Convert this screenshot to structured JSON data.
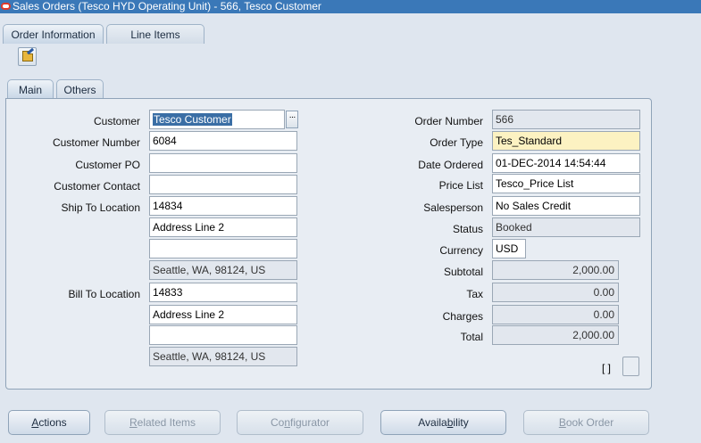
{
  "window": {
    "title": "Sales Orders (Tesco HYD Operating Unit) - 566, Tesco Customer"
  },
  "tabs": {
    "order_information": "Order Information",
    "line_items": "Line Items"
  },
  "subtabs": {
    "main": "Main",
    "others": "Others"
  },
  "labels": {
    "customer": "Customer",
    "customer_number": "Customer Number",
    "customer_po": "Customer PO",
    "customer_contact": "Customer Contact",
    "ship_to_location": "Ship To Location",
    "bill_to_location": "Bill To Location",
    "order_number": "Order Number",
    "order_type": "Order Type",
    "date_ordered": "Date Ordered",
    "price_list": "Price List",
    "salesperson": "Salesperson",
    "status": "Status",
    "currency": "Currency",
    "subtotal": "Subtotal",
    "tax": "Tax",
    "charges": "Charges",
    "total": "Total"
  },
  "values": {
    "customer": "Tesco Customer",
    "customer_number": "6084",
    "customer_po": "",
    "customer_contact": "",
    "ship_to_location": "14834",
    "ship_to_address1": "Address Line 2",
    "ship_to_address2": "",
    "ship_to_address3": "Seattle, WA, 98124, US",
    "bill_to_location": "14833",
    "bill_to_address1": "Address Line 2",
    "bill_to_address2": "",
    "bill_to_address3": "Seattle, WA, 98124, US",
    "order_number": "566",
    "order_type": "Tes_Standard",
    "date_ordered": "01-DEC-2014 14:54:44",
    "price_list": "Tesco_Price List",
    "salesperson": "No Sales Credit",
    "status": "Booked",
    "currency": "USD",
    "subtotal": "2,000.00",
    "tax": "0.00",
    "charges": "0.00",
    "total": "2,000.00"
  },
  "lov_glyph": "···",
  "flex_brackets": "[ ]",
  "buttons": {
    "actions": {
      "first": "A",
      "rest": "ctions"
    },
    "related_items": {
      "first": "R",
      "rest": "elated Items"
    },
    "configurator": {
      "pre": "Co",
      "mid": "n",
      "rest": "figurator"
    },
    "availability": {
      "pre": "Availa",
      "mid": "b",
      "rest": "ility"
    },
    "book_order": {
      "first": "B",
      "rest": "ook Order"
    }
  },
  "icons": {
    "oracle": "oracle-icon",
    "open_folder": "open-folder-icon",
    "lov": "ellipsis-icon"
  },
  "colors": {
    "titlebar": "#3a78b8",
    "required_field": "#fcf2c2",
    "readonly_field": "#e2e7ee"
  }
}
